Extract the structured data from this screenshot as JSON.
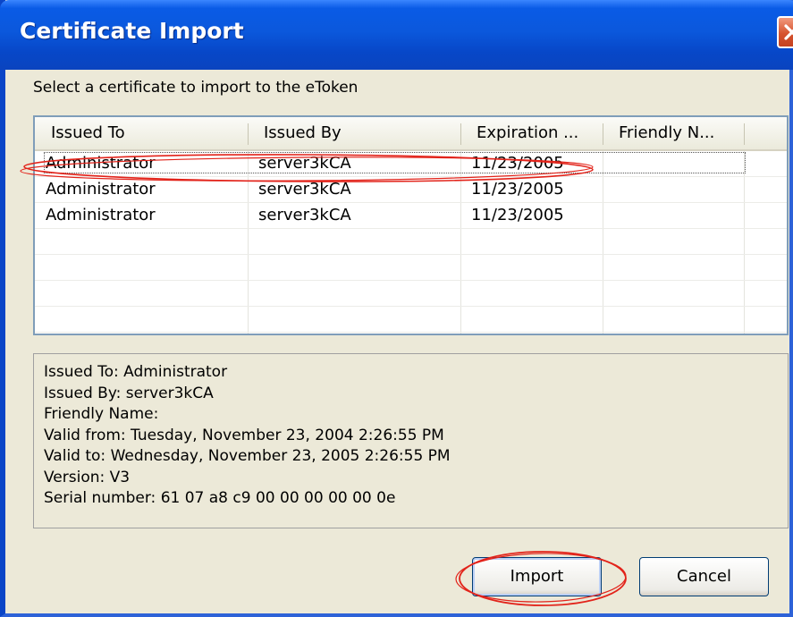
{
  "window": {
    "title": "Certificate Import"
  },
  "instruction": "Select a certificate to import to the eToken",
  "table": {
    "columns": [
      "Issued To",
      "Issued By",
      "Expiration ...",
      "Friendly N..."
    ],
    "rows": [
      [
        "Administrator",
        "server3kCA",
        "11/23/2005",
        ""
      ],
      [
        "Administrator",
        "server3kCA",
        "11/23/2005",
        ""
      ],
      [
        "Administrator",
        "server3kCA",
        "11/23/2005",
        ""
      ]
    ]
  },
  "details": [
    "Issued To: Administrator",
    "Issued By: server3kCA",
    "Friendly Name:",
    "Valid from: Tuesday, November 23, 2004 2:26:55 PM",
    "Valid to: Wednesday, November 23, 2005 2:26:55 PM",
    "Version: V3",
    "Serial number: 61 07 a8 c9 00 00 00 00 00 0e"
  ],
  "buttons": {
    "import": "Import",
    "cancel": "Cancel"
  },
  "colors": {
    "titlebar": "#0a5be6",
    "annotation": "#e2231a",
    "dialog_bg": "#ece9d8"
  },
  "icons": {
    "close": "close-icon"
  }
}
